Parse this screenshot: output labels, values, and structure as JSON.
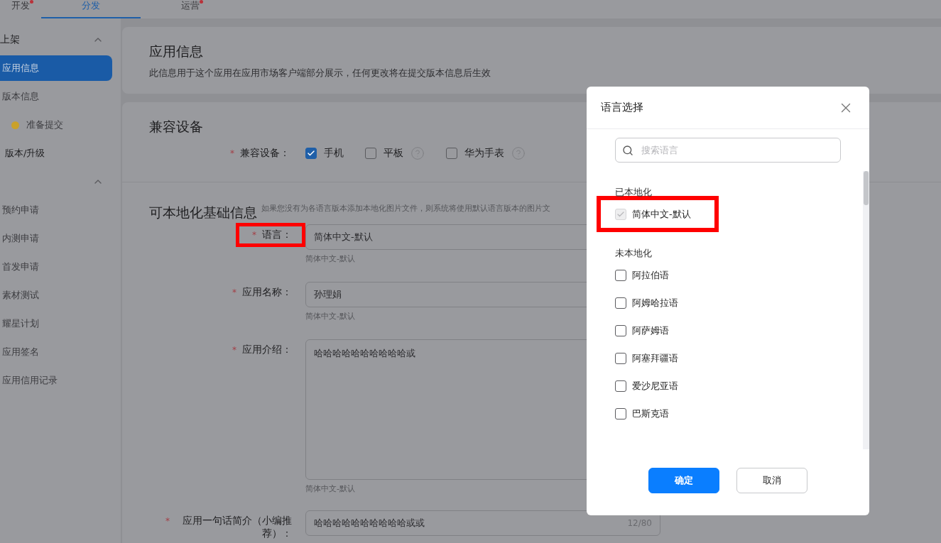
{
  "top_tabs": [
    {
      "label": "开发",
      "selected": false,
      "badge": true
    },
    {
      "label": "分发",
      "selected": true,
      "badge": false
    },
    {
      "label": "运营",
      "selected": false,
      "badge": true
    }
  ],
  "sidebar": {
    "groups": [
      {
        "title": "上架",
        "expanded": true,
        "items": [
          {
            "label": "应用信息",
            "kind": "item",
            "selected": true
          },
          {
            "label": "版本信息",
            "kind": "item",
            "selected": false
          },
          {
            "label": "准备提交",
            "kind": "status",
            "selected": false,
            "color": "#c9a12b"
          },
          {
            "label": "版本/升级",
            "kind": "heading",
            "selected": false
          }
        ]
      },
      {
        "expanded": true,
        "items": [
          {
            "label": "预约申请",
            "kind": "item",
            "selected": false
          },
          {
            "label": "内测申请",
            "kind": "item",
            "selected": false
          },
          {
            "label": "首发申请",
            "kind": "item",
            "selected": false
          },
          {
            "label": "素材测试",
            "kind": "item",
            "selected": false
          },
          {
            "label": "耀星计划",
            "kind": "item",
            "selected": false
          },
          {
            "label": "应用签名",
            "kind": "item",
            "selected": false
          },
          {
            "label": "应用信用记录",
            "kind": "item",
            "selected": false
          }
        ]
      }
    ]
  },
  "app_info": {
    "title": "应用信息",
    "description": "此信息用于这个应用在应用市场客户端部分展示，任何更改将在提交版本信息后生效"
  },
  "compat": {
    "title": "兼容设备",
    "label": "兼容设备：",
    "required": true,
    "required_mark": "*",
    "options": [
      {
        "label": "手机",
        "checked": true,
        "help": false
      },
      {
        "label": "平板",
        "checked": false,
        "help": true
      },
      {
        "label": "华为手表",
        "checked": false,
        "help": true
      }
    ]
  },
  "localized": {
    "title": "可本地化基础信息",
    "hint": "如果您没有为各语言版本添加本地化图片文件，则系统将使用默认语言版本的图片文",
    "fields": [
      {
        "label": "语言：",
        "required": true,
        "required_mark": "*",
        "kind": "input",
        "value": "简体中文-默认",
        "hint": "简体中文-默认",
        "highlighted": true
      },
      {
        "label": "应用名称：",
        "required": true,
        "required_mark": "*",
        "kind": "input",
        "value": "孙理娟",
        "hint": "简体中文-默认",
        "highlighted": false
      },
      {
        "label": "应用介绍：",
        "required": true,
        "required_mark": "*",
        "kind": "textarea",
        "value": "哈哈哈哈哈哈哈哈哈哈或",
        "hint": "简体中文-默认",
        "highlighted": false
      },
      {
        "label": "应用一句话简介（小编推荐）：",
        "required": true,
        "required_mark": "*",
        "kind": "input",
        "value": "哈哈哈哈哈哈哈哈哈哈或或",
        "counter": "12/80",
        "highlighted": false
      }
    ]
  },
  "modal": {
    "title": "语言选择",
    "search": {
      "placeholder": "搜索语言"
    },
    "sections": [
      {
        "heading": "已本地化",
        "items": [
          {
            "label": "简体中文-默认",
            "checked": true,
            "disabled": true,
            "highlighted": true
          }
        ]
      },
      {
        "heading": "未本地化",
        "items": [
          {
            "label": "阿拉伯语",
            "checked": false,
            "disabled": false,
            "highlighted": false
          },
          {
            "label": "阿姆哈拉语",
            "checked": false,
            "disabled": false,
            "highlighted": false
          },
          {
            "label": "阿萨姆语",
            "checked": false,
            "disabled": false,
            "highlighted": false
          },
          {
            "label": "阿塞拜疆语",
            "checked": false,
            "disabled": false,
            "highlighted": false
          },
          {
            "label": "爱沙尼亚语",
            "checked": false,
            "disabled": false,
            "highlighted": false
          },
          {
            "label": "巴斯克语",
            "checked": false,
            "disabled": false,
            "highlighted": false
          }
        ]
      }
    ],
    "buttons": [
      {
        "label": "确定",
        "kind": "primary"
      },
      {
        "label": "取消",
        "kind": "secondary"
      }
    ]
  }
}
